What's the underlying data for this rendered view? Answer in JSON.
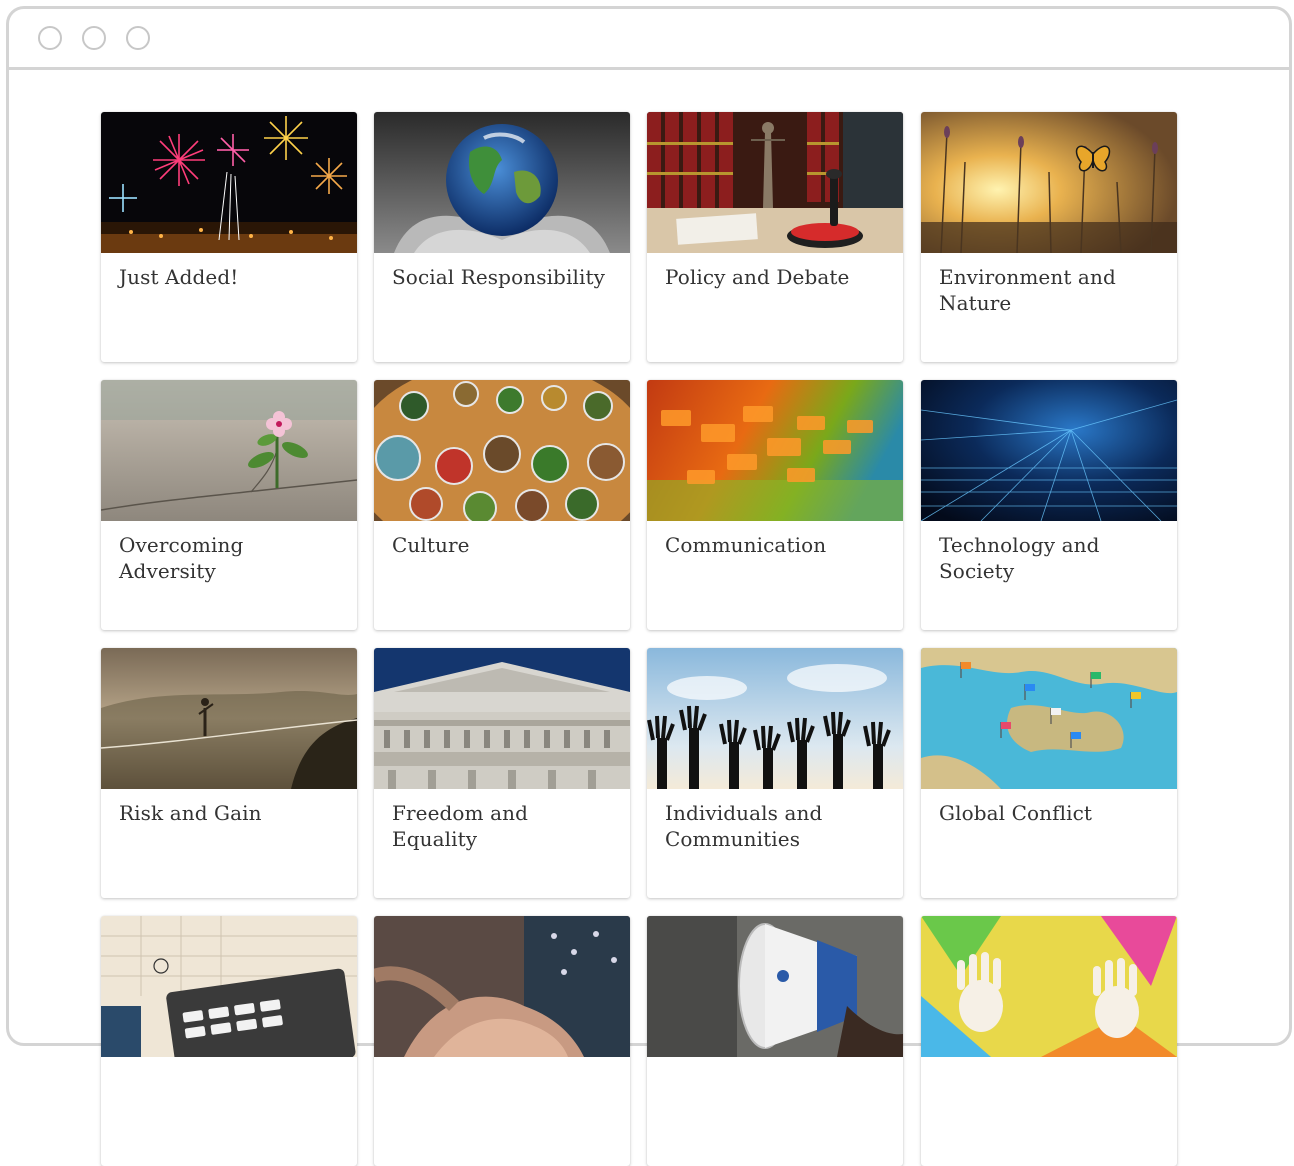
{
  "window": {
    "controls": [
      "circle-icon",
      "circle-icon",
      "circle-icon"
    ]
  },
  "cards": [
    {
      "title": "Just Added!",
      "image": "fireworks-image"
    },
    {
      "title": "Social Responsibility",
      "image": "earth-in-hands-image"
    },
    {
      "title": "Policy and Debate",
      "image": "law-desk-image"
    },
    {
      "title": "Environment and Nature",
      "image": "butterfly-meadow-image"
    },
    {
      "title": "Overcoming Adversity",
      "image": "flower-in-crack-image"
    },
    {
      "title": "Culture",
      "image": "food-bowls-image"
    },
    {
      "title": "Communication",
      "image": "speech-bubbles-image"
    },
    {
      "title": "Technology and Society",
      "image": "digital-grid-image"
    },
    {
      "title": "Risk and Gain",
      "image": "tightrope-walker-image"
    },
    {
      "title": "Freedom and Equality",
      "image": "court-facade-image"
    },
    {
      "title": "Individuals and Communities",
      "image": "raised-hands-image"
    },
    {
      "title": "Global Conflict",
      "image": "map-pins-image"
    },
    {
      "title": "",
      "image": "calculator-calendar-image"
    },
    {
      "title": "",
      "image": "holding-hands-image"
    },
    {
      "title": "",
      "image": "megaphone-image"
    },
    {
      "title": "",
      "image": "painted-handprints-image"
    }
  ],
  "colors": {
    "frame_border": "#d4d4d4",
    "card_text": "#333333",
    "background": "#ffffff"
  }
}
